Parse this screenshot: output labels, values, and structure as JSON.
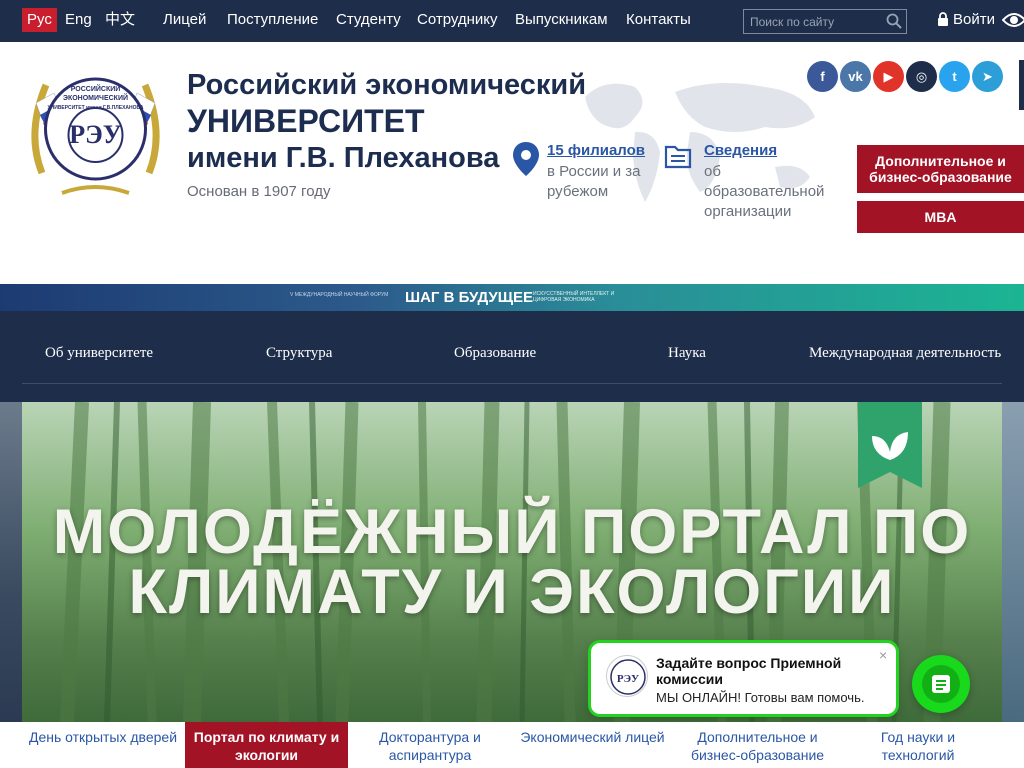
{
  "topbar": {
    "languages": [
      "Рус",
      "Eng",
      "中文"
    ],
    "nav": [
      "Лицей",
      "Поступление",
      "Студенту",
      "Сотруднику",
      "Выпускникам",
      "Контакты"
    ],
    "search_placeholder": "Поиск по сайту",
    "login_label": "Войти"
  },
  "header": {
    "name_line1": "Российский экономический",
    "name_line2": "УНИВЕРСИТЕТ",
    "name_line3": "имени Г.В. Плеханова",
    "founded": "Основан в 1907 году",
    "branches_link": "15 филиалов",
    "branches_sub": "в России и за рубежом",
    "info_link": "Сведения",
    "info_sub": "об образовательной организации",
    "logo_text": [
      "РОССИЙСКИЙ",
      "ЭКОНОМИЧЕСКИЙ",
      "УНИВЕРСИТЕТ имени Г.В.ПЛЕХАНОВА"
    ]
  },
  "socials": [
    {
      "name": "facebook-icon",
      "glyph": "f",
      "color": "#3b5998"
    },
    {
      "name": "vk-icon",
      "glyph": "vk",
      "color": "#4a76a8"
    },
    {
      "name": "youtube-icon",
      "glyph": "▶",
      "color": "#e0342b"
    },
    {
      "name": "instagram-icon",
      "glyph": "◎",
      "color": "#1e2d4a"
    },
    {
      "name": "twitter-icon",
      "glyph": "t",
      "color": "#2aa3ef"
    },
    {
      "name": "telegram-icon",
      "glyph": "➤",
      "color": "#2c9fd9"
    }
  ],
  "buttons": {
    "extra_education": "Дополнительное и бизнес-образование",
    "mba": "MBA"
  },
  "banner": {
    "left_small": "V МЕЖДУНАРОДНЫЙ НАУЧНЫЙ ФОРУМ",
    "title": "ШАГ В БУДУЩЕЕ",
    "right_small": "ИСКУССТВЕННЫЙ ИНТЕЛЛЕКТ И ЦИФРОВАЯ ЭКОНОМИКА"
  },
  "mainnav": [
    "Об университете",
    "Структура",
    "Образование",
    "Наука",
    "Международная деятельность"
  ],
  "hero": {
    "title_line1": "МОЛОДЁЖНЫЙ ПОРТАЛ ПО",
    "title_line2": "КЛИМАТУ И ЭКОЛОГИИ"
  },
  "chat": {
    "question": "Задайте вопрос Приемной комиссии",
    "online": "МЫ ОНЛАЙН! Готовы вам помочь.",
    "close": "×"
  },
  "tabs": [
    {
      "label": "День открытых дверей",
      "active": false
    },
    {
      "label": "Портал по климату и экологии",
      "active": true
    },
    {
      "label": "Докторантура и аспирантура",
      "active": false
    },
    {
      "label": "Экономический лицей",
      "active": false
    },
    {
      "label": "Дополнительное и бизнес-образование",
      "active": false
    },
    {
      "label": "Год науки и технологий",
      "active": false
    }
  ],
  "colors": {
    "navy": "#1e2d4a",
    "brand_red": "#a31326",
    "link_blue": "#2a57a5",
    "chat_green": "#23d31f"
  }
}
